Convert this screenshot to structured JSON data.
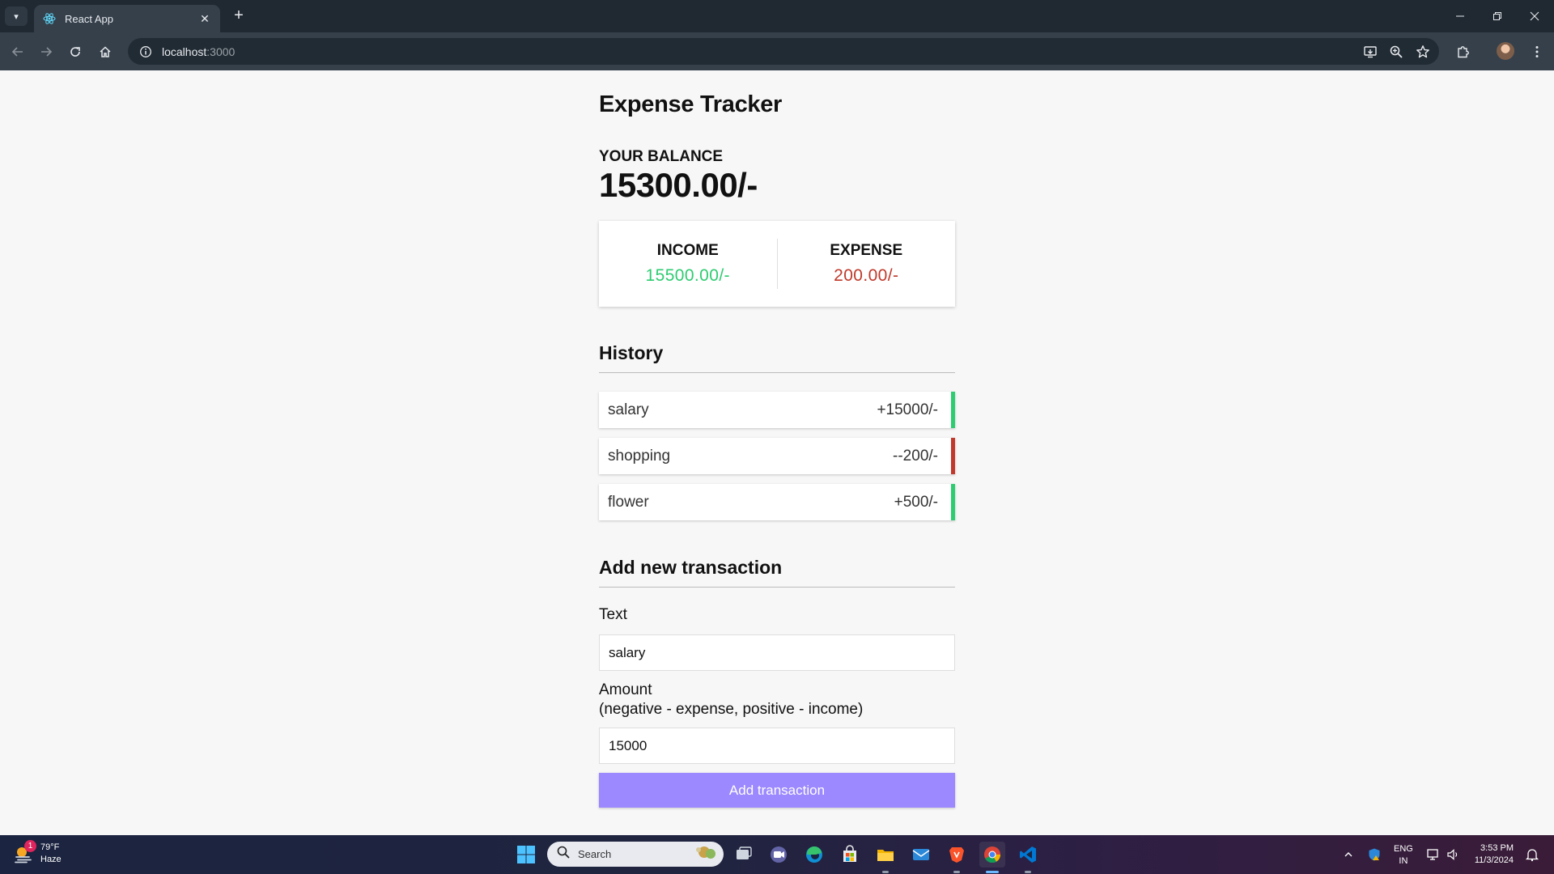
{
  "browser": {
    "tab_title": "React App",
    "url_host": "localhost",
    "url_port": ":3000"
  },
  "app": {
    "title": "Expense Tracker",
    "balance_label": "YOUR BALANCE",
    "balance_value": "15300.00/-",
    "income_label": "INCOME",
    "income_value": "15500.00/-",
    "expense_label": "EXPENSE",
    "expense_value": "200.00/-",
    "history_title": "History",
    "history": [
      {
        "text": "salary",
        "amount": "+15000/-",
        "type": "plus"
      },
      {
        "text": "shopping",
        "amount": "--200/-",
        "type": "minus"
      },
      {
        "text": "flower",
        "amount": "+500/-",
        "type": "plus"
      }
    ],
    "add_title": "Add new transaction",
    "text_label": "Text",
    "text_value": "salary",
    "amount_label": "Amount",
    "amount_hint": "(negative - expense, positive - income)",
    "amount_value": "15000",
    "button_label": "Add transaction"
  },
  "colors": {
    "income": "#2ecc71",
    "expense": "#c0392b",
    "button": "#9c88ff"
  },
  "taskbar": {
    "weather_temp": "79°F",
    "weather_desc": "Haze",
    "weather_badge": "1",
    "search_placeholder": "Search",
    "lang_line1": "ENG",
    "lang_line2": "IN",
    "time": "3:53 PM",
    "date": "11/3/2024"
  }
}
